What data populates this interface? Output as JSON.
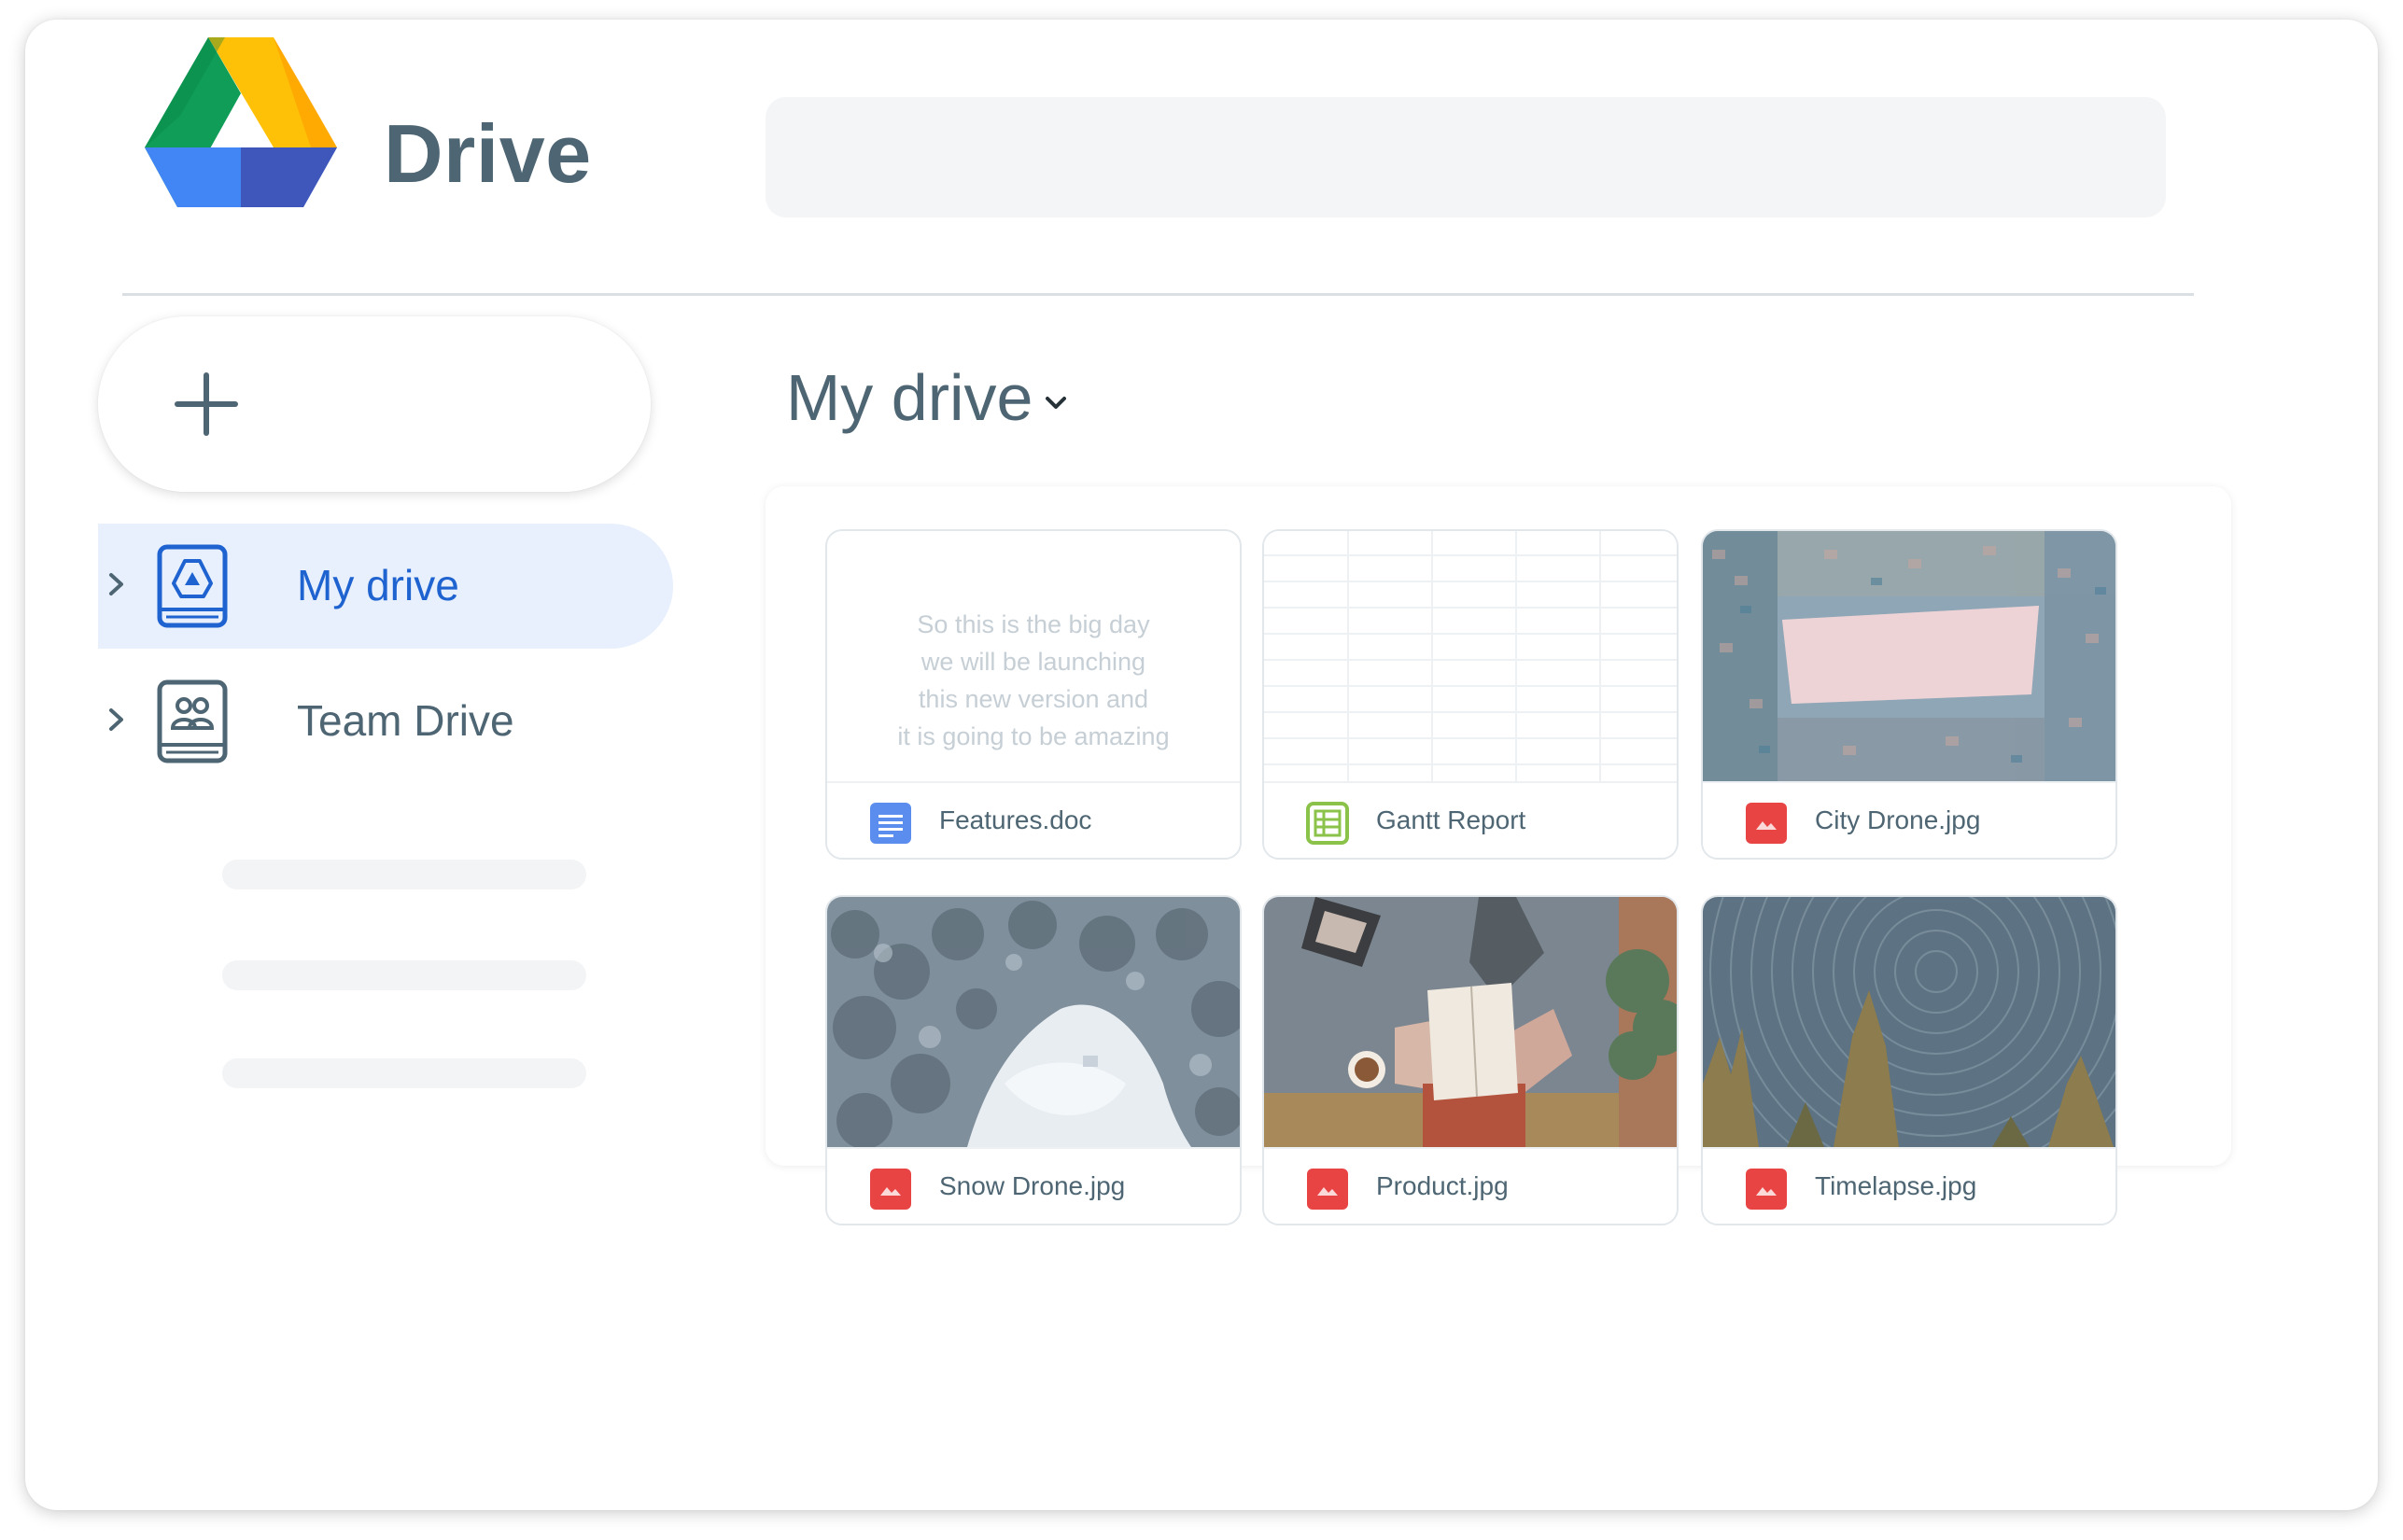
{
  "app": {
    "brand": "Drive",
    "logo_icon": "google-drive-logo",
    "colors": {
      "brand_text": "#4e6673",
      "accent_blue": "#1f63d0",
      "active_nav_bg": "#e8f0fd",
      "doc_icon": "#5b8def",
      "sheet_icon": "#8bc34a",
      "image_icon": "#e94444"
    }
  },
  "header": {
    "search_placeholder": ""
  },
  "sidebar": {
    "new_button_icon": "plus-icon",
    "items": [
      {
        "label": "My drive",
        "icon": "drive-book-icon",
        "active": true
      },
      {
        "label": "Team Drive",
        "icon": "team-book-icon",
        "active": false
      }
    ]
  },
  "main": {
    "title": "My drive",
    "title_icon": "chevron-down-icon",
    "files": [
      {
        "name": "Features.doc",
        "type": "doc",
        "preview_lines": [
          "So this is the big day",
          "we will be launching",
          "this new version and",
          "it is going to be amazing"
        ]
      },
      {
        "name": "Gantt Report",
        "type": "sheet"
      },
      {
        "name": "City Drone.jpg",
        "type": "image"
      },
      {
        "name": "Snow Drone.jpg",
        "type": "image"
      },
      {
        "name": "Product.jpg",
        "type": "image"
      },
      {
        "name": "Timelapse.jpg",
        "type": "image"
      }
    ]
  }
}
